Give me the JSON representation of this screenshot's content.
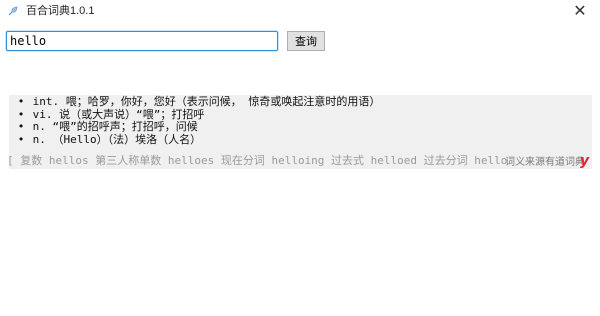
{
  "window": {
    "title": "百合词典1.0.1",
    "close_glyph": "✕"
  },
  "search": {
    "value": "hello",
    "button_label": "查询"
  },
  "definitions": [
    {
      "bullet": "•",
      "text": "int. 喂；哈罗，你好，您好（表示问候， 惊奇或唤起注意时的用语）"
    },
    {
      "bullet": "•",
      "text": "vi. 说（或大声说）“喂”；打招呼"
    },
    {
      "bullet": "•",
      "text": "n. “喂”的招呼声；打招呼，问候"
    },
    {
      "bullet": "•",
      "text": "n. （Hello）（法）埃洛（人名）"
    }
  ],
  "word_forms": "[ 复数 hellos 第三人称单数 helloes 现在分词 helloing 过去式 helloed 过去分词 helloed ]",
  "source_note": "词义来源有道词典",
  "logo_text": "y",
  "colors": {
    "input_border": "#2f8fd8",
    "logo": "#e3262d"
  },
  "icons": {
    "app": "feather-icon",
    "close": "close-icon",
    "logo": "youdao-logo-icon"
  }
}
